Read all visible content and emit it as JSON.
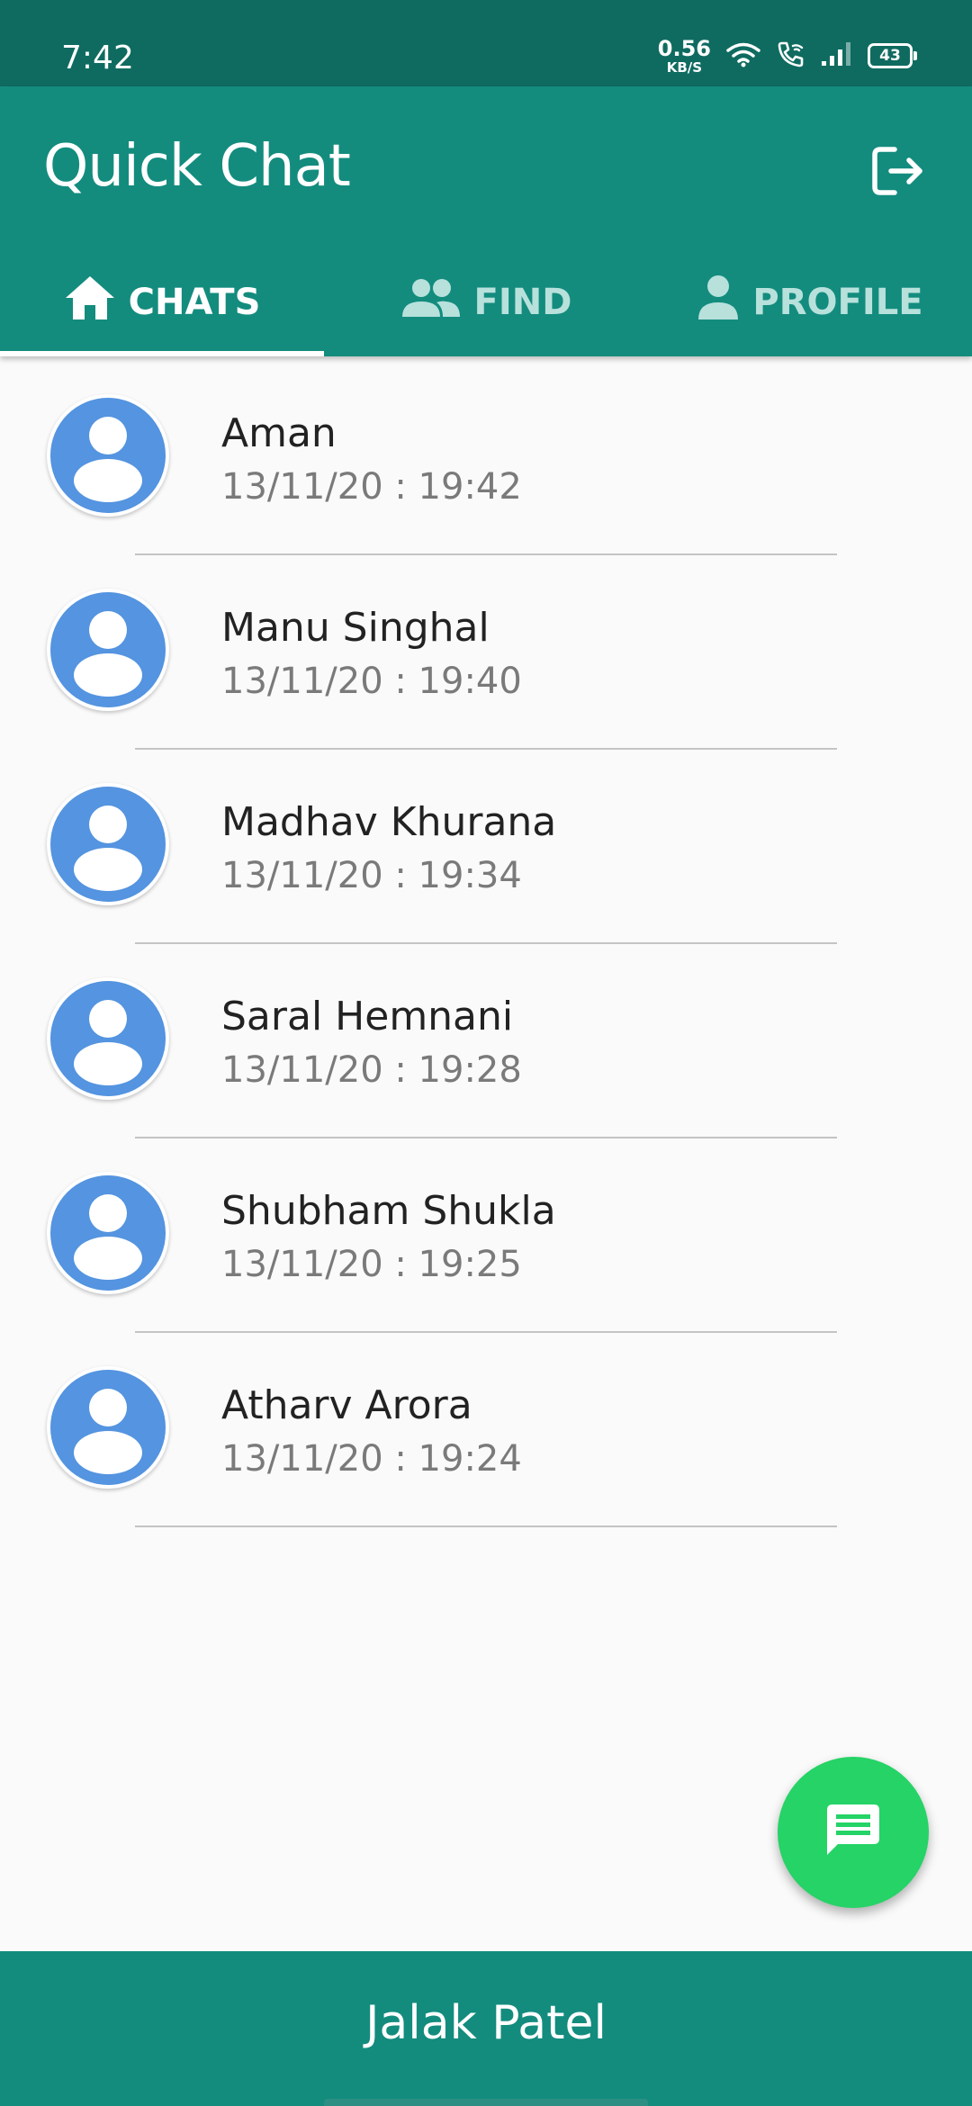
{
  "status_bar": {
    "time": "7:42",
    "net_speed_value": "0.56",
    "net_speed_unit": "KB/S",
    "battery": "43",
    "icons": [
      "wifi-icon",
      "wifi-calling-icon",
      "signal-icon",
      "battery-icon"
    ]
  },
  "app_bar": {
    "title": "Quick Chat",
    "logout_icon": "logout-icon"
  },
  "tabs": [
    {
      "label": "CHATS",
      "icon": "home-icon",
      "active": true
    },
    {
      "label": "FIND",
      "icon": "people-icon",
      "active": false
    },
    {
      "label": "PROFILE",
      "icon": "person-icon",
      "active": false
    }
  ],
  "chats": [
    {
      "name": "Aman",
      "time": "13/11/20 : 19:42"
    },
    {
      "name": "Manu Singhal",
      "time": "13/11/20 : 19:40"
    },
    {
      "name": "Madhav Khurana",
      "time": "13/11/20 : 19:34"
    },
    {
      "name": "Saral Hemnani",
      "time": "13/11/20 : 19:28"
    },
    {
      "name": "Shubham Shukla",
      "time": "13/11/20 : 19:25"
    },
    {
      "name": "Atharv Arora",
      "time": "13/11/20 : 19:24"
    }
  ],
  "fab": {
    "icon": "message-icon"
  },
  "bottom_bar": {
    "name": "Jalak Patel"
  },
  "colors": {
    "status_bar": "#0f6b60",
    "primary": "#138c7e",
    "fab": "#25d366",
    "avatar": "#5494e0",
    "background": "#fafafa"
  }
}
